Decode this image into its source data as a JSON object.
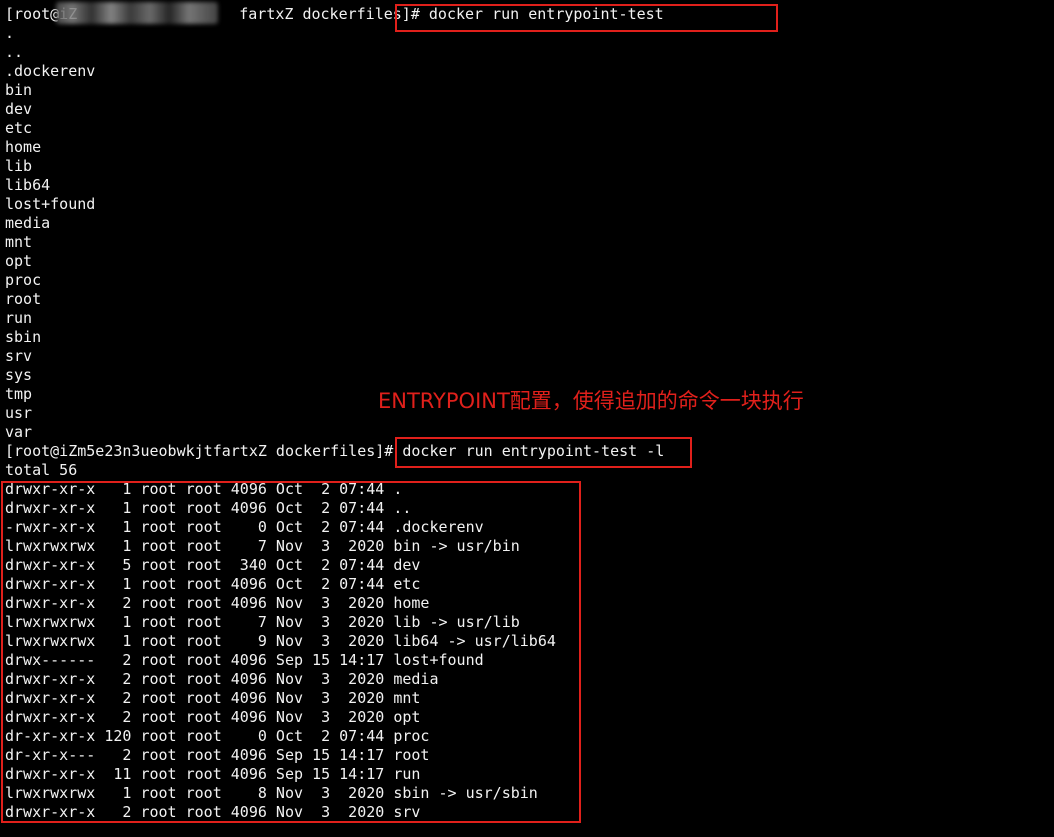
{
  "terminal": {
    "prompt1_host": "[root@iZ",
    "prompt1_tail": "fartxZ dockerfiles]#",
    "command1": "docker run entrypoint-test",
    "ls_output": [
      ".",
      "..",
      ".dockerenv",
      "bin",
      "dev",
      "etc",
      "home",
      "lib",
      "lib64",
      "lost+found",
      "media",
      "mnt",
      "opt",
      "proc",
      "root",
      "run",
      "sbin",
      "srv",
      "sys",
      "tmp",
      "usr",
      "var"
    ],
    "prompt2": "[root@iZm5e23n3ueobwkjtfartxZ dockerfiles]#",
    "command2": "docker run entrypoint-test -l",
    "total_line": "total 56",
    "ls_long_output": [
      "drwxr-xr-x   1 root root 4096 Oct  2 07:44 .",
      "drwxr-xr-x   1 root root 4096 Oct  2 07:44 ..",
      "-rwxr-xr-x   1 root root    0 Oct  2 07:44 .dockerenv",
      "lrwxrwxrwx   1 root root    7 Nov  3  2020 bin -> usr/bin",
      "drwxr-xr-x   5 root root  340 Oct  2 07:44 dev",
      "drwxr-xr-x   1 root root 4096 Oct  2 07:44 etc",
      "drwxr-xr-x   2 root root 4096 Nov  3  2020 home",
      "lrwxrwxrwx   1 root root    7 Nov  3  2020 lib -> usr/lib",
      "lrwxrwxrwx   1 root root    9 Nov  3  2020 lib64 -> usr/lib64",
      "drwx------   2 root root 4096 Sep 15 14:17 lost+found",
      "drwxr-xr-x   2 root root 4096 Nov  3  2020 media",
      "drwxr-xr-x   2 root root 4096 Nov  3  2020 mnt",
      "drwxr-xr-x   2 root root 4096 Nov  3  2020 opt",
      "dr-xr-xr-x 120 root root    0 Oct  2 07:44 proc",
      "dr-xr-x---   2 root root 4096 Sep 15 14:17 root",
      "drwxr-xr-x  11 root root 4096 Sep 15 14:17 run",
      "lrwxrwxrwx   1 root root    8 Nov  3  2020 sbin -> usr/sbin",
      "drwxr-xr-x   2 root root 4096 Nov  3  2020 srv"
    ]
  },
  "annotation": {
    "text": "ENTRYPOINT配置，使得追加的命令一块执行"
  },
  "colors": {
    "background": "#000000",
    "text": "#f2f2f2",
    "highlight": "#e0201b"
  }
}
